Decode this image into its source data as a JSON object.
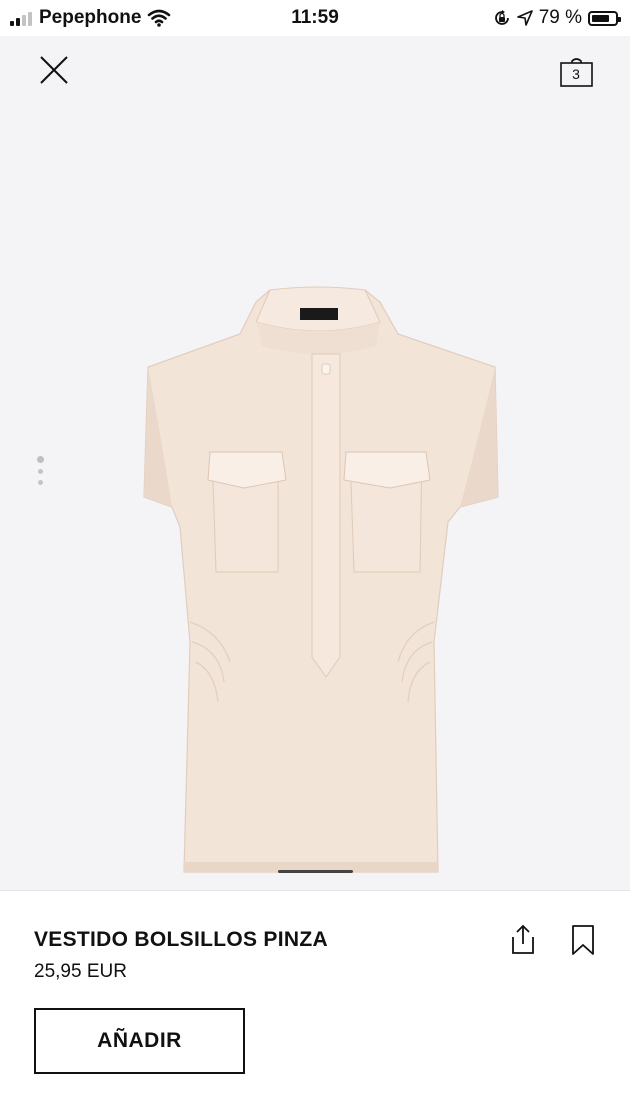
{
  "status_bar": {
    "carrier": "Pepephone",
    "time": "11:59",
    "battery": "79 %",
    "battery_level": 0.79
  },
  "header": {
    "close_icon": "close-icon",
    "bag_icon": "shopping-bag-icon",
    "bag_count": "3"
  },
  "gallery": {
    "image_alt": "sleeveless shirt dress with chest flap pockets",
    "dots_count": 3,
    "active_dot": 0
  },
  "product": {
    "name": "VESTIDO BOLSILLOS PINZA",
    "price": "25,95 EUR",
    "add_label": "AÑADIR"
  },
  "colors": {
    "gallery_bg": "#f4f3f5",
    "garment": "#f3e4d8",
    "text": "#111111"
  }
}
